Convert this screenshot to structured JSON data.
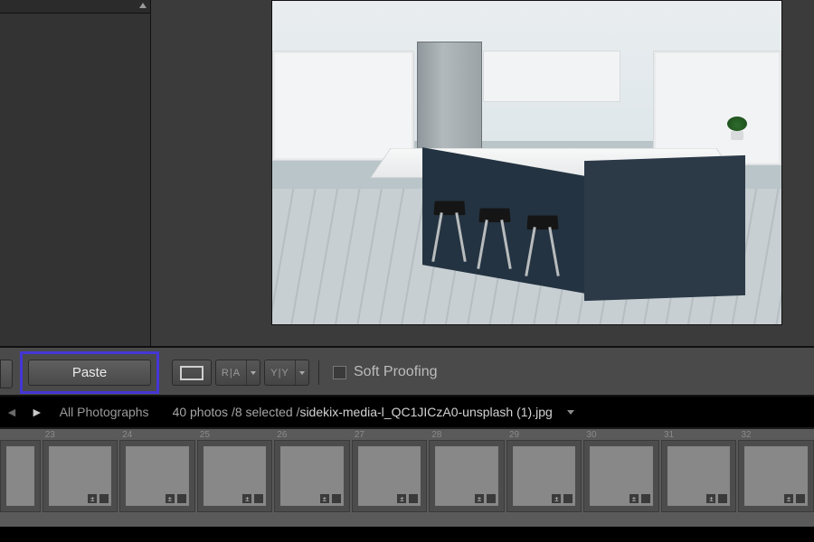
{
  "toolbar": {
    "paste_label": "Paste",
    "view_compare_ra": "R|A",
    "view_compare_yy": "Y|Y",
    "soft_proofing_label": "Soft Proofing",
    "soft_proofing_checked": false
  },
  "breadcrumb": {
    "source": "All Photographs",
    "count_text": "40 photos /8 selected /",
    "filename": "sidekix-media-l_QC1JICzA0-unsplash (1).jpg"
  },
  "filmstrip": {
    "items": [
      {
        "index": "",
        "thumb_class": "t1",
        "badge": false
      },
      {
        "index": "23",
        "thumb_class": "t1",
        "badge": true
      },
      {
        "index": "24",
        "thumb_class": "t2",
        "badge": true
      },
      {
        "index": "25",
        "thumb_class": "t3",
        "badge": true
      },
      {
        "index": "26",
        "thumb_class": "t4",
        "badge": true
      },
      {
        "index": "27",
        "thumb_class": "t5",
        "badge": true
      },
      {
        "index": "28",
        "thumb_class": "t6",
        "badge": true
      },
      {
        "index": "29",
        "thumb_class": "t7",
        "badge": true
      },
      {
        "index": "30",
        "thumb_class": "t8",
        "badge": true
      },
      {
        "index": "31",
        "thumb_class": "t9",
        "badge": true
      },
      {
        "index": "32",
        "thumb_class": "t10",
        "badge": true
      }
    ]
  },
  "icons": {
    "edit_badge": "±"
  }
}
